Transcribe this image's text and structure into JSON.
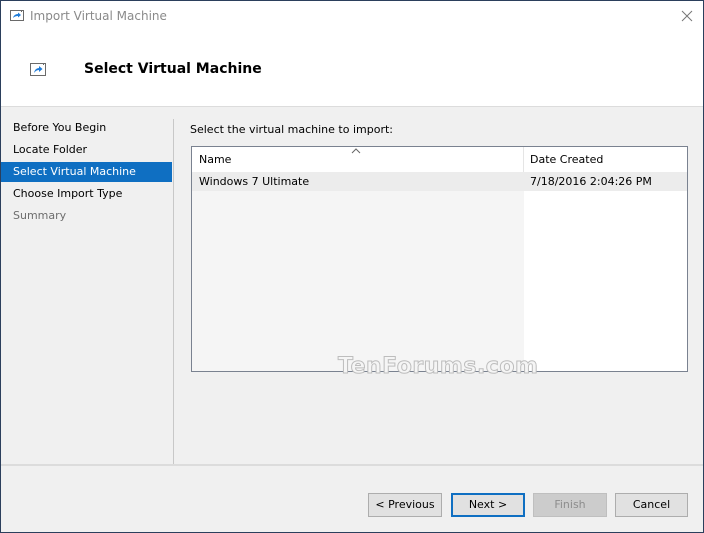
{
  "window": {
    "title": "Import Virtual Machine"
  },
  "header": {
    "title": "Select Virtual Machine"
  },
  "sidebar": {
    "items": [
      {
        "label": "Before You Begin",
        "state": "normal"
      },
      {
        "label": "Locate Folder",
        "state": "normal"
      },
      {
        "label": "Select Virtual Machine",
        "state": "active"
      },
      {
        "label": "Choose Import Type",
        "state": "normal"
      },
      {
        "label": "Summary",
        "state": "disabled"
      }
    ]
  },
  "main": {
    "prompt": "Select the virtual machine to import:",
    "table": {
      "columns": [
        "Name",
        "Date Created"
      ],
      "sort_column": "Name",
      "sort_direction": "ascending",
      "rows": [
        {
          "name": "Windows 7 Ultimate",
          "date_created": "7/18/2016 2:04:26 PM"
        }
      ]
    }
  },
  "footer": {
    "previous_label": "< Previous",
    "next_label": "Next >",
    "finish_label": "Finish",
    "cancel_label": "Cancel"
  },
  "watermark": "TenForums.com",
  "colors": {
    "accent": "#0f6fc2",
    "window_border": "#2b3f5c"
  }
}
